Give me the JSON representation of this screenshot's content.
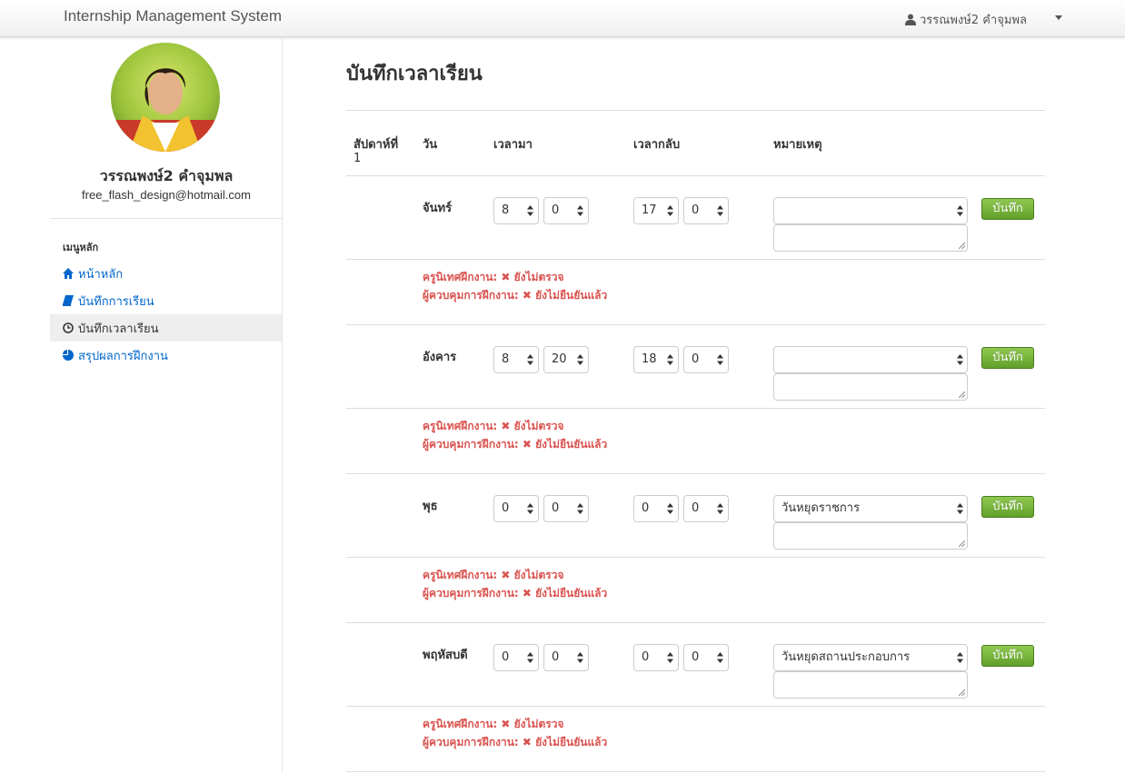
{
  "navbar": {
    "brand": "Internship Management System",
    "user_name": "วรรณพงษ์2 คำจุมพล"
  },
  "profile": {
    "name": "วรรณพงษ์2 คำจุมพล",
    "email": "free_flash_design@hotmail.com"
  },
  "menu": {
    "header": "เมนูหลัก",
    "items": [
      {
        "label": "หน้าหลัก",
        "icon": "home-icon"
      },
      {
        "label": "บันทึกการเรียน",
        "icon": "book-icon"
      },
      {
        "label": "บันทึกเวลาเรียน",
        "icon": "clock-icon",
        "active": true
      },
      {
        "label": "สรุปผลการฝึกงาน",
        "icon": "pie-chart-icon"
      }
    ]
  },
  "page": {
    "title": "บันทึกเวลาเรียน",
    "columns": {
      "week": "สัปดาห์ที่",
      "week_no": "1",
      "day": "วัน",
      "time_in": "เวลามา",
      "time_out": "เวลากลับ",
      "note": "หมายเหตุ"
    },
    "save_label": "บันทึก",
    "status_labels": {
      "teacher": "ครูนิเทศฝึกงาน:",
      "supervisor": "ผู้ควบคุมการฝึกงาน:",
      "not_checked": "ยังไม่ตรวจ",
      "not_confirmed": "ยังไม่ยืนยันแล้ว",
      "x": "✖"
    },
    "rows": [
      {
        "day": "จันทร์",
        "in_h": "8",
        "in_m": "0",
        "out_h": "17",
        "out_m": "0",
        "note": ""
      },
      {
        "day": "อังคาร",
        "in_h": "8",
        "in_m": "20",
        "out_h": "18",
        "out_m": "0",
        "note": ""
      },
      {
        "day": "พุธ",
        "in_h": "0",
        "in_m": "0",
        "out_h": "0",
        "out_m": "0",
        "note": "วันหยุดราชการ"
      },
      {
        "day": "พฤหัสบดี",
        "in_h": "0",
        "in_m": "0",
        "out_h": "0",
        "out_m": "0",
        "note": "วันหยุดสถานประกอบการ"
      }
    ]
  },
  "colors": {
    "link": "#0066cc",
    "status_red": "#d9534f",
    "save_green": "#6fae35"
  }
}
